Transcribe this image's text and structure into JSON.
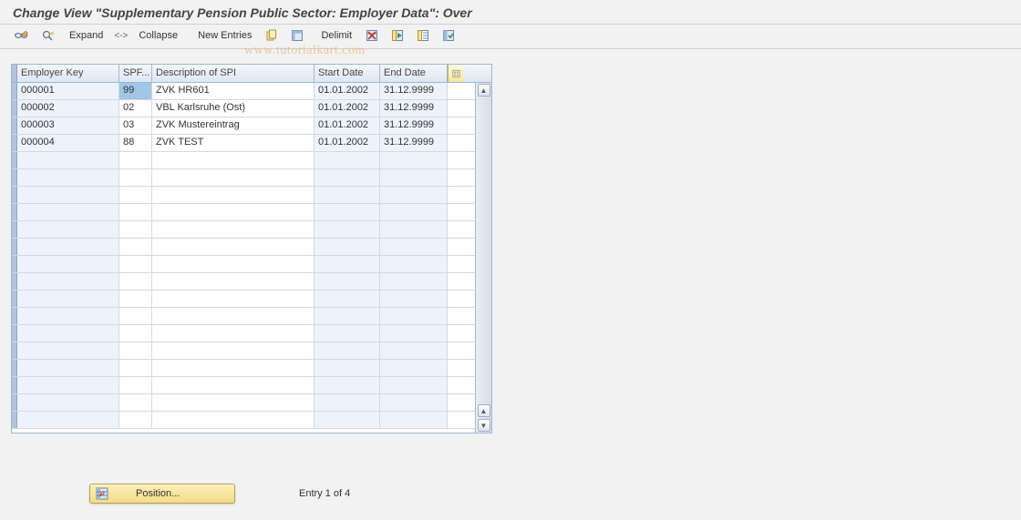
{
  "title": "Change View \"Supplementary Pension Public Sector: Employer Data\": Over",
  "toolbar": {
    "expand": "Expand",
    "arrow": "<->",
    "collapse": "Collapse",
    "newEntries": "New Entries",
    "delimit": "Delimit"
  },
  "watermark": "www.tutorialkart.com",
  "columns": {
    "employerKey": "Employer Key",
    "spf": "SPF...",
    "description": "Description of SPI",
    "startDate": "Start Date",
    "endDate": "End Date"
  },
  "rows": [
    {
      "employerKey": "000001",
      "spf": "99",
      "description": "ZVK HR601",
      "startDate": "01.01.2002",
      "endDate": "31.12.9999",
      "selected": true
    },
    {
      "employerKey": "000002",
      "spf": "02",
      "description": "VBL Karlsruhe (Ost)",
      "startDate": "01.01.2002",
      "endDate": "31.12.9999",
      "selected": false
    },
    {
      "employerKey": "000003",
      "spf": "03",
      "description": "ZVK Mustereintrag",
      "startDate": "01.01.2002",
      "endDate": "31.12.9999",
      "selected": false
    },
    {
      "employerKey": "000004",
      "spf": "88",
      "description": "ZVK TEST",
      "startDate": "01.01.2002",
      "endDate": "31.12.9999",
      "selected": false
    }
  ],
  "emptyRows": 16,
  "footer": {
    "positionLabel": "Position...",
    "entryLabel": "Entry 1 of 4"
  },
  "icons": {
    "glasses": "glasses-icon",
    "magnify": "magnify-brush-icon",
    "copy": "copy-icon",
    "selectAll": "select-all-icon",
    "delete": "delete-icon",
    "checkCol": "column-check-icon",
    "gridCol": "column-grid-icon",
    "docCol": "column-doc-icon",
    "settings": "settings-icon",
    "scrollUp": "scroll-up-icon",
    "scrollDown": "scroll-down-icon",
    "pos": "position-icon"
  }
}
